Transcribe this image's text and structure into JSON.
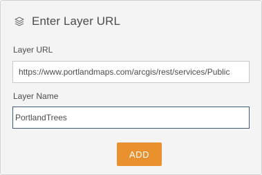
{
  "header": {
    "icon": "layers-icon",
    "title": "Enter Layer URL"
  },
  "form": {
    "url_label": "Layer URL",
    "url_value": "https://www.portlandmaps.com/arcgis/rest/services/Public",
    "name_label": "Layer Name",
    "name_value": "PortlandTrees"
  },
  "actions": {
    "add_label": "ADD"
  },
  "colors": {
    "accent": "#e8912e",
    "panel_background": "#f4f4f4",
    "focus_border": "#3d5c7a"
  }
}
